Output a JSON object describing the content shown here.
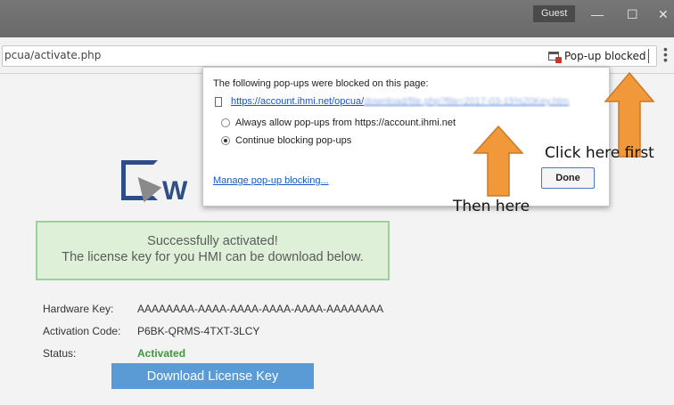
{
  "window": {
    "guest_label": "Guest",
    "minimize_glyph": "—",
    "maximize_glyph": "☐",
    "close_glyph": "✕"
  },
  "toolbar": {
    "url": "pcua/activate.php",
    "popup_chip_label": "Pop-up blocked"
  },
  "popup_bubble": {
    "header": "The following pop-ups were blocked on this page:",
    "link_visible": "https://account.ihmi.net/opcua/",
    "link_blurred": "download/file.php?file=2017-03-15%20Key.htm",
    "option_allow": "Always allow pop-ups from https://account.ihmi.net",
    "option_block": "Continue blocking pop-ups",
    "selected_option": "block",
    "manage_link": "Manage pop-up blocking...",
    "done_label": "Done"
  },
  "annotations": {
    "first": "Click here first",
    "second": "Then here",
    "arrow_color": "#f0983a"
  },
  "page": {
    "logo_letter": "W",
    "success_line1": "Successfully activated!",
    "success_line2": "The license key for you HMI can be download below.",
    "hardware_key_label": "Hardware Key:",
    "hardware_key_value": "AAAAAAAA-AAAA-AAAA-AAAA-AAAA-AAAAAAAA",
    "activation_code_label": "Activation Code:",
    "activation_code_value": "P6BK-QRMS-4TXT-3LCY",
    "status_label": "Status:",
    "status_value": "Activated",
    "download_button": "Download License Key"
  }
}
